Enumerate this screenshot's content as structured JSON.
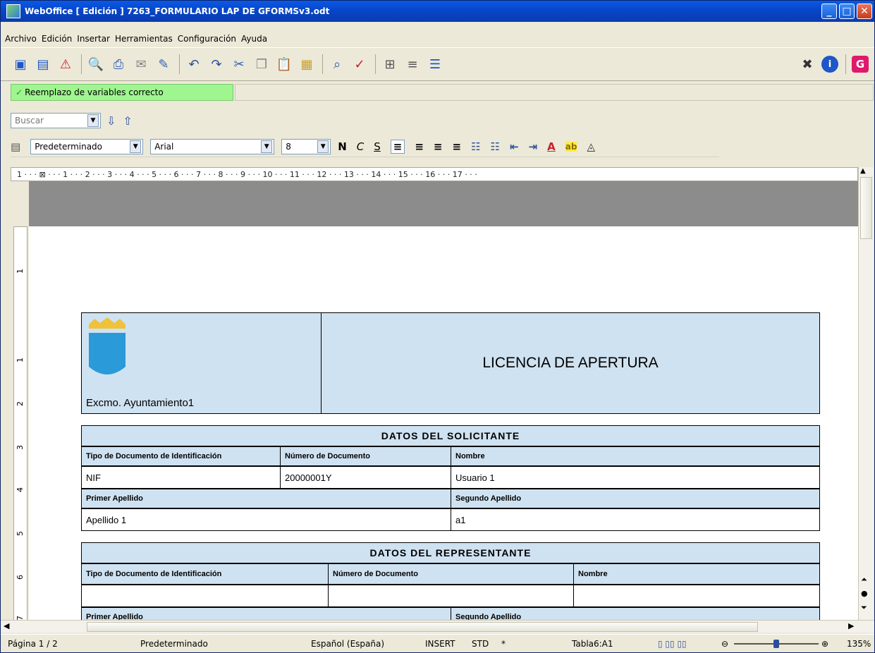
{
  "window": {
    "title": "WebOffice [ Edición ] 7263_FORMULARIO LAP DE GFORMSv3.odt"
  },
  "menu": [
    "Archivo",
    "Edición",
    "Insertar",
    "Herramientas",
    "Configuración",
    "Ayuda"
  ],
  "status_message": "Reemplazo de variables correcto",
  "find": {
    "placeholder": "Buscar"
  },
  "format": {
    "style": "Predeterminado",
    "font": "Arial",
    "size": "8",
    "bold": "N",
    "italic": "C",
    "underline": "S"
  },
  "ruler_text": "1 · · · ⊠ · · · 1 · · · 2 · · · 3 · · · 4 · · · 5 · · · 6 · · · 7 · · · 8 · · · 9 · · · 10 · · · 11 · · · 12 · · · 13 · · · 14 · · · 15 · · · 16 · · · 17 · · ·",
  "vruler_labels": [
    "1",
    "1",
    "2",
    "3",
    "4",
    "5",
    "6",
    "7"
  ],
  "doc": {
    "header_title": "LICENCIA DE APERTURA",
    "org": "Excmo. Ayuntamiento1",
    "solicitante": {
      "heading": "DATOS DEL SOLICITANTE",
      "col1": "Tipo de Documento de Identificación",
      "col2": "Número de Documento",
      "col3": "Nombre",
      "v1": "NIF",
      "v2": "20000001Y",
      "v3": "Usuario 1",
      "col4": "Primer Apellido",
      "col5": "Segundo Apellido",
      "v4": "Apellido 1",
      "v5": "a1"
    },
    "representante": {
      "heading": "DATOS DEL REPRESENTANTE",
      "col1": "Tipo de Documento de Identificación",
      "col2": "Número de Documento",
      "col3": "Nombre",
      "col4": "Primer Apellido",
      "col5": "Segundo Apellido"
    }
  },
  "statusbar": {
    "page": "Página 1 / 2",
    "style": "Predeterminado",
    "lang": "Español (España)",
    "insert": "INSERT",
    "std": "STD",
    "mod": "*",
    "cell": "Tabla6:A1",
    "zoom": "135%"
  }
}
